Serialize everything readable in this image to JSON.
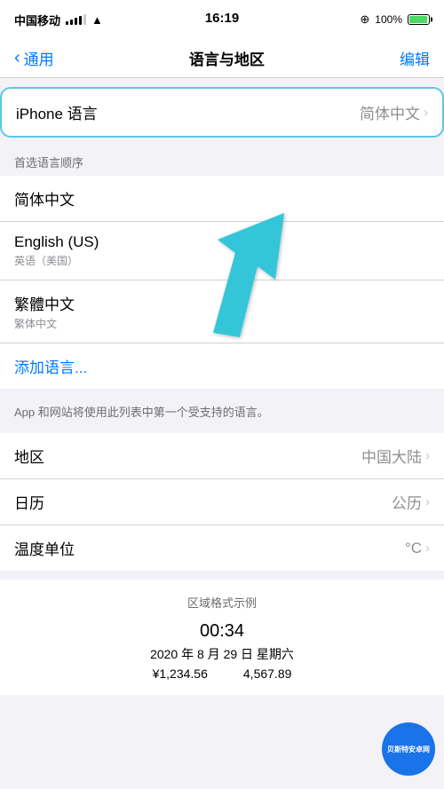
{
  "status_bar": {
    "carrier": "中国移动",
    "time": "16:19",
    "battery_percent": "100%",
    "charging": true
  },
  "nav": {
    "back_label": "通用",
    "title": "语言与地区",
    "action_label": "编辑"
  },
  "iphone_language": {
    "label": "iPhone 语言",
    "value": "简体中文"
  },
  "preferred_languages": {
    "section_header": "首选语言顺序",
    "languages": [
      {
        "main": "简体中文",
        "sub": ""
      },
      {
        "main": "English (US)",
        "sub": "英语（美国）"
      },
      {
        "main": "繁體中文",
        "sub": "繁体中文"
      }
    ],
    "add_label": "添加语言..."
  },
  "description": "App 和网站将使用此列表中第一个受支持的语言。",
  "region_settings": [
    {
      "label": "地区",
      "value": "中国大陆"
    },
    {
      "label": "日历",
      "value": "公历"
    },
    {
      "label": "温度单位",
      "value": "°C"
    }
  ],
  "format_example": {
    "title": "区域格式示例",
    "time": "00:34",
    "date": "2020 年 8 月 29 日 星期六",
    "number1": "¥1,234.56",
    "number2": "4,567.89"
  },
  "watermark": {
    "text": "贝斯特安卓网"
  }
}
